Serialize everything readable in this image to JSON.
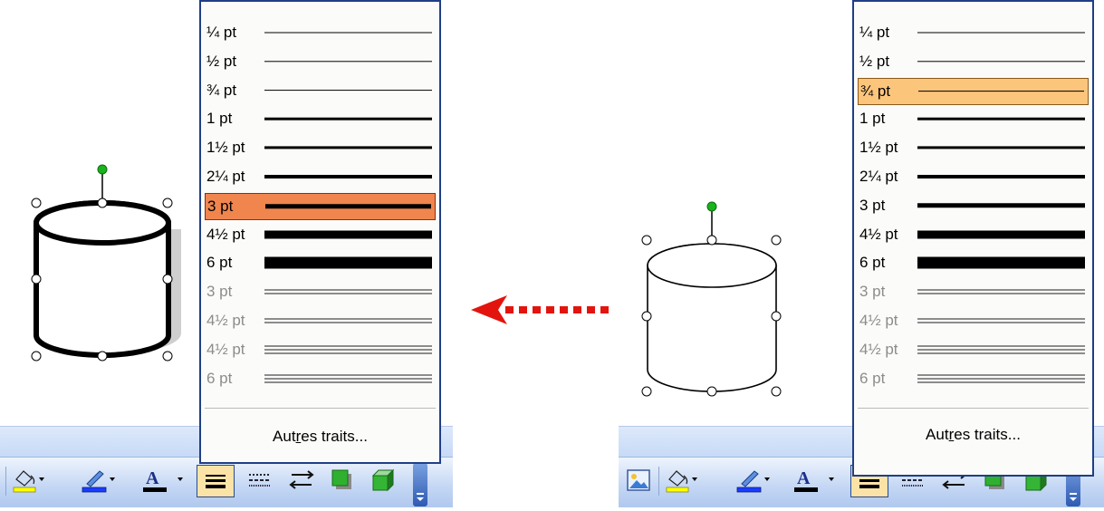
{
  "menu": {
    "weights": [
      {
        "label": "¼ pt",
        "kind": "single",
        "weight": 1
      },
      {
        "label": "½ pt",
        "kind": "single",
        "weight": 1.4
      },
      {
        "label": "¾ pt",
        "kind": "single",
        "weight": 1.8
      },
      {
        "label": "1 pt",
        "kind": "single",
        "weight": 2.6
      },
      {
        "label": "1½ pt",
        "kind": "single",
        "weight": 3.2
      },
      {
        "label": "2¼ pt",
        "kind": "single",
        "weight": 4
      },
      {
        "label": "3 pt",
        "kind": "single",
        "weight": 5.5
      },
      {
        "label": "4½ pt",
        "kind": "single",
        "weight": 9
      },
      {
        "label": "6 pt",
        "kind": "single",
        "weight": 13
      },
      {
        "label": "3 pt",
        "kind": "double",
        "weight": 3
      },
      {
        "label": "4½ pt",
        "kind": "double",
        "weight": 4
      },
      {
        "label": "4½ pt",
        "kind": "triple",
        "weight": 5
      },
      {
        "label": "6 pt",
        "kind": "triple",
        "weight": 6
      }
    ],
    "more_label_pre": "Aut",
    "more_label_underline": "r",
    "more_label_post": "es traits..."
  },
  "left_panel": {
    "selected_label": "3 pt"
  },
  "right_panel": {
    "selected_label": "¾ pt"
  },
  "colors": {
    "menu_border": "#1f3f86",
    "highlight_left": "#f0854e",
    "highlight_right": "#fbc57c",
    "handle_green": "#19b31b",
    "arrow_red": "#e3140e"
  },
  "toolbar": {
    "icons": [
      "insert-picture-icon",
      "fill-color-icon",
      "line-color-icon",
      "font-color-icon",
      "line-style-icon",
      "dash-style-icon",
      "arrow-style-icon",
      "shadow-style-icon",
      "3d-style-icon",
      "toolbar-options-icon"
    ],
    "font_color_glyph": "A"
  }
}
